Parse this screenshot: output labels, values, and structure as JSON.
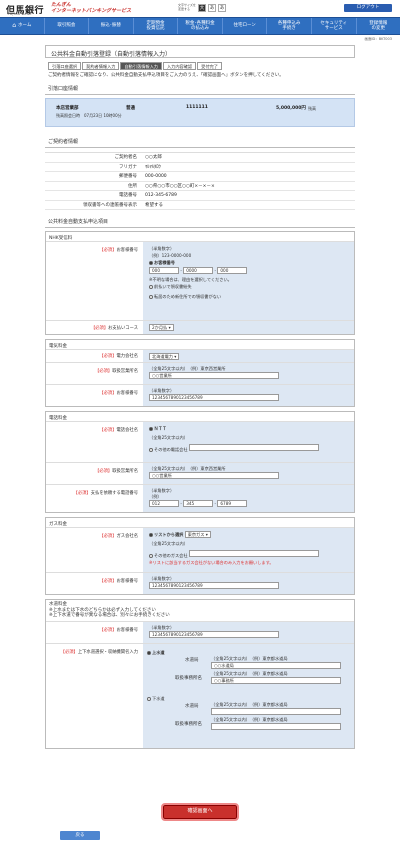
{
  "header": {
    "logo": "但馬銀行",
    "logo_sub": "TAJIMA BANK",
    "service_line1": "たんぎん",
    "service_line2": "インターネットバンキングサービス",
    "fontsize_label": "文字サイズを\n変更する",
    "fontsize_options": [
      "大",
      "あ",
      "あ"
    ],
    "logout": "ログアウト"
  },
  "nav": [
    "ホーム",
    "取引照会",
    "振込･振替",
    "定期預金\n投資信託",
    "税金･各種料金\nの払込み",
    "住宅ローン",
    "各種申込み\n手続き",
    "セキュリティ\nサービス",
    "登録情報\nの変更"
  ],
  "screen_id": "画面ID：BKT003",
  "title": "公共料金自動引落登録（自動引落情報入力）",
  "steps": [
    "引落口座選択",
    "契約者情報入力",
    "自動引落情報入力",
    "入力内容確認",
    "受付完了"
  ],
  "intro": "ご契約者情報をご確認になり、公共料金自動支払申込項目をご入力のうえ、「確認画面へ」ボタンを押してください。",
  "account_section": "引落口座情報",
  "account": {
    "branch": "本店営業部",
    "type": "普通",
    "number": "1111111",
    "balance": "5,000,000円",
    "balance_label": "残高",
    "time": "残高照会日時　07月23日 10時00分"
  },
  "contract_section": "ご契約者情報",
  "contract": [
    {
      "k": "ご契約者名",
      "v": "○○太郎"
    },
    {
      "k": "フリガナ",
      "v": "ﾏﾙﾏﾙﾀﾛｳ"
    },
    {
      "k": "郵便番号",
      "v": "000-0000"
    },
    {
      "k": "住所",
      "v": "○○県○○市○○区○○町×－×－×"
    },
    {
      "k": "電話番号",
      "v": "012-345-6789"
    },
    {
      "k": "領収書等への連帳番号表示",
      "v": "希望する"
    }
  ],
  "apply_section": "公共料金自動支払申込項目",
  "nhk": {
    "title": "NHK受信料",
    "req": "【必須】",
    "cust_label": "お客様番号",
    "hint1": "（半角数字）",
    "hint2": "（例）123-0000-000",
    "opt_select": "お客様番号",
    "f1": "000",
    "f2": "0000",
    "f3": "000",
    "unknown": "※不明な場合は、理由を選択してください。",
    "r1": "前払いで領収書紛失",
    "r2": "転居のため新住所での領収書がない",
    "pay_label": "お支払いコース",
    "pay_value": "2か月払"
  },
  "elec": {
    "title": "電気料金",
    "company_label": "電力会社名",
    "company_value": "北海道電力",
    "office_label": "取扱営業所名",
    "office_hint1": "（全角25文字以内）",
    "office_hint2": "（例）東京西営業所",
    "office_value": "○○営業所",
    "num_label": "お客様番号",
    "num_hint": "（半角数字）",
    "num_value": "1234567890123456789"
  },
  "tel": {
    "title": "電話料金",
    "company_label": "電話会社名",
    "opt1": "ＮＴＴ",
    "hint": "（全角25文字以内）",
    "opt2": "その他の電話会社",
    "office_label": "取扱営業所名",
    "office_hint1": "（全角25文字以内）",
    "office_hint2": "（例）東京西営業所",
    "office_value": "○○営業所",
    "main_label": "支払を依頼する電話番号",
    "main_hint": "（半角数字）",
    "main_hint2": "（例）",
    "p1": "012",
    "p2": "345",
    "p3": "6789"
  },
  "gas": {
    "title": "ガス料金",
    "company_label": "ガス会社名",
    "opt1": "リストから選択",
    "opt1_value": "東京ガス",
    "hint": "（全角25文字以内）",
    "opt2": "その他のガス会社",
    "warn": "※リストに該当するガス会社がない場合のみ入力をお願いします。",
    "num_label": "お客様番号",
    "num_hint": "（半角数字）",
    "num_value": "1234567890123456789"
  },
  "water": {
    "title": "水道料金",
    "note1": "※上水または下水のどちらかは必ず入力してください",
    "note2": "※上下水道で番号が異なる場合は、別々にお手続きください",
    "num_label": "お客様番号",
    "num_hint": "（半角数字）",
    "num_value": "1234567890123456789",
    "sel_label": "上下水道選択・収納機関名入力",
    "up": "上水道",
    "down": "下水道",
    "bureau": "水道局",
    "office": "取扱事務所名",
    "hint": "（全角25文字以内）",
    "ex_bureau": "（例）東京都水道局",
    "ex_office": "（例）東京都水道局",
    "up_bureau": "○○水道局",
    "up_office": "○○事務所"
  },
  "buttons": {
    "submit": "確認画面へ",
    "back": "戻る"
  }
}
